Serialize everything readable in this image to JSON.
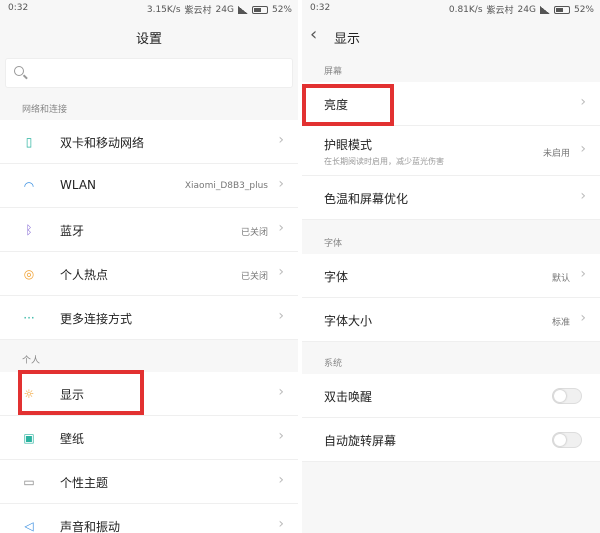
{
  "left": {
    "status": {
      "time": "0:32",
      "speed": "3.15K/s",
      "carrier": "紫云村",
      "network": "24G",
      "battery": "52%"
    },
    "title": "设置",
    "search": {
      "placeholder": ""
    },
    "sections": [
      {
        "label": "网络和连接"
      },
      {
        "label": "个人"
      }
    ],
    "items": [
      {
        "label": "双卡和移动网络",
        "value": ""
      },
      {
        "label": "WLAN",
        "value": "Xiaomi_D8B3_plus"
      },
      {
        "label": "蓝牙",
        "value": "已关闭"
      },
      {
        "label": "个人热点",
        "value": "已关闭"
      },
      {
        "label": "更多连接方式",
        "value": ""
      },
      {
        "label": "显示",
        "value": ""
      },
      {
        "label": "壁纸",
        "value": ""
      },
      {
        "label": "个性主题",
        "value": ""
      },
      {
        "label": "声音和振动",
        "value": ""
      }
    ]
  },
  "right": {
    "status": {
      "time": "0:32",
      "speed": "0.81K/s",
      "carrier": "紫云村",
      "network": "24G",
      "battery": "52%"
    },
    "title": "显示",
    "sections": [
      {
        "label": "屏幕"
      },
      {
        "label": "字体"
      },
      {
        "label": "系统"
      }
    ],
    "items": [
      {
        "label": "亮度",
        "value": ""
      },
      {
        "label": "护眼模式",
        "sub": "在长期阅读时启用，减少蓝光伤害",
        "value": "未启用"
      },
      {
        "label": "色温和屏幕优化",
        "value": ""
      },
      {
        "label": "字体",
        "value": "默认"
      },
      {
        "label": "字体大小",
        "value": "标准"
      },
      {
        "label": "双击唤醒",
        "toggle": false
      },
      {
        "label": "自动旋转屏幕",
        "toggle": false
      }
    ]
  },
  "colors": {
    "highlight": "#e23131",
    "accent": "#2bb3a0"
  }
}
